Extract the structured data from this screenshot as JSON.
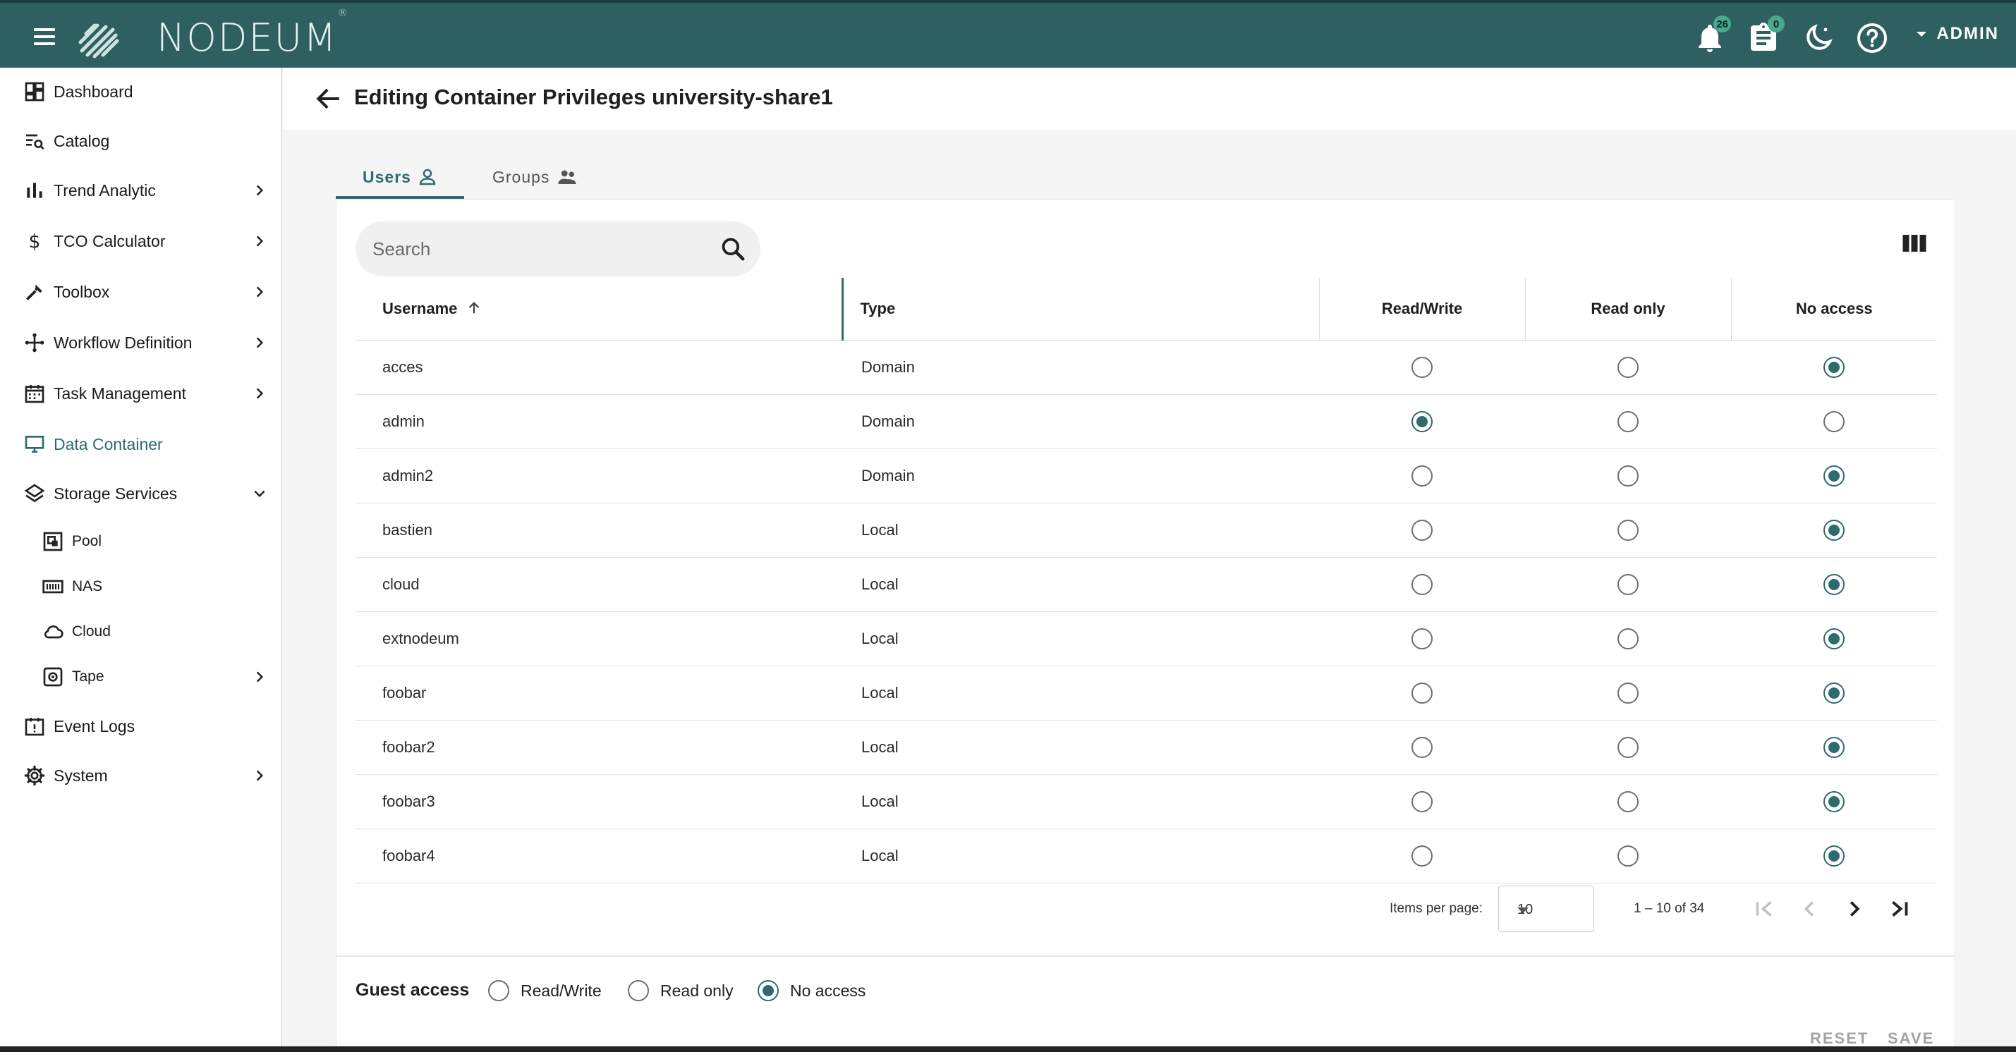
{
  "app": {
    "brand": "NODEUM",
    "trademark": "®",
    "notifications_count": "26",
    "tasks_count": "0",
    "user": "ADMIN"
  },
  "sidebar": {
    "items": [
      {
        "label": "Dashboard",
        "icon": "dashboard-icon"
      },
      {
        "label": "Catalog",
        "icon": "catalog-icon"
      },
      {
        "label": "Trend Analytic",
        "icon": "bar-chart-icon"
      },
      {
        "label": "TCO Calculator",
        "icon": "dollar-icon"
      },
      {
        "label": "Toolbox",
        "icon": "tools-icon"
      },
      {
        "label": "Workflow Definition",
        "icon": "workflow-icon"
      },
      {
        "label": "Task Management",
        "icon": "calendar-icon"
      },
      {
        "label": "Data Container",
        "icon": "monitor-icon"
      },
      {
        "label": "Storage Services",
        "icon": "layers-icon"
      },
      {
        "label": "Pool",
        "icon": "pool-icon"
      },
      {
        "label": "NAS",
        "icon": "nas-icon"
      },
      {
        "label": "Cloud",
        "icon": "cloud-icon"
      },
      {
        "label": "Tape",
        "icon": "tape-icon"
      },
      {
        "label": "Event Logs",
        "icon": "event-icon"
      },
      {
        "label": "System",
        "icon": "gear-icon"
      }
    ]
  },
  "page": {
    "title": "Editing Container Privileges university-share1"
  },
  "tabs": [
    {
      "label": "Users"
    },
    {
      "label": "Groups"
    }
  ],
  "search": {
    "placeholder": "Search",
    "value": ""
  },
  "table": {
    "headers": {
      "username": "Username",
      "type": "Type",
      "rw": "Read/Write",
      "ro": "Read only",
      "na": "No access"
    },
    "rows": [
      {
        "username": "acces",
        "type": "Domain",
        "access": "na"
      },
      {
        "username": "admin",
        "type": "Domain",
        "access": "rw"
      },
      {
        "username": "admin2",
        "type": "Domain",
        "access": "na"
      },
      {
        "username": "bastien",
        "type": "Local",
        "access": "na"
      },
      {
        "username": "cloud",
        "type": "Local",
        "access": "na"
      },
      {
        "username": "extnodeum",
        "type": "Local",
        "access": "na"
      },
      {
        "username": "foobar",
        "type": "Local",
        "access": "na"
      },
      {
        "username": "foobar2",
        "type": "Local",
        "access": "na"
      },
      {
        "username": "foobar3",
        "type": "Local",
        "access": "na"
      },
      {
        "username": "foobar4",
        "type": "Local",
        "access": "na"
      }
    ]
  },
  "pagination": {
    "items_per_page_label": "Items per page:",
    "items_per_page": "10",
    "range": "1 – 10 of 34"
  },
  "guest": {
    "label": "Guest access",
    "options": [
      "Read/Write",
      "Read only",
      "No access"
    ],
    "selected": "No access"
  },
  "actions": {
    "reset": "RESET",
    "save": "SAVE"
  },
  "colors": {
    "topbar": "#2e5f61",
    "accent": "#2e6b6e",
    "badge": "#4aa88c"
  }
}
